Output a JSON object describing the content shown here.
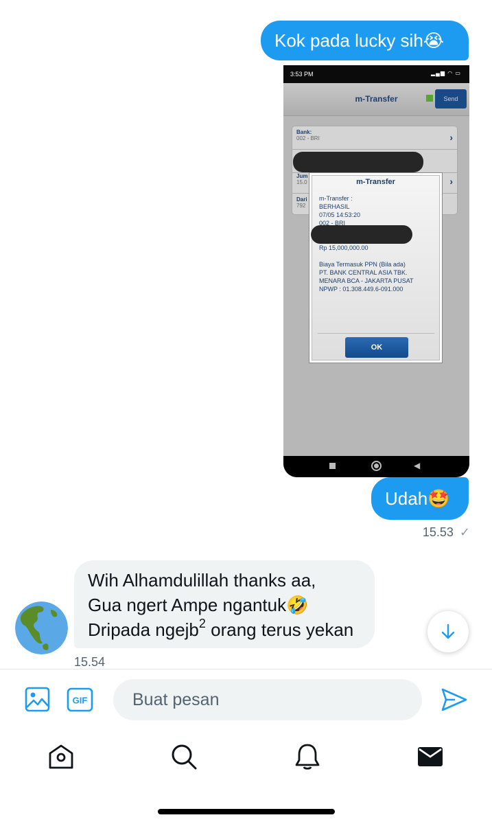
{
  "conversation": {
    "messages": [
      {
        "direction": "outgoing",
        "text": "Kok pada lucky sih😭"
      },
      {
        "direction": "outgoing",
        "type": "image",
        "image": {
          "status_time": "3:53 PM",
          "app_title": "m-Transfer",
          "send_label": "Send",
          "rows": [
            {
              "label": "Bank:",
              "value": "002 - BRI"
            },
            {
              "label": "Jum",
              "value": "15.0"
            },
            {
              "label": "Dari",
              "value": "792"
            }
          ],
          "dialog": {
            "title": "m-Transfer",
            "lines": [
              "m-Transfer :",
              "BERHASIL",
              "07/05 14:53:20",
              "002 - BRI",
              "Rp 15,000,000.00",
              "Biaya Termasuk PPN (Bila ada)",
              "PT. BANK CENTRAL ASIA TBK.",
              "MENARA BCA - JAKARTA PUSAT",
              "NPWP : 01.308.449.6-091.000"
            ],
            "ok_label": "OK"
          }
        }
      },
      {
        "direction": "outgoing",
        "text": "Udah🤩"
      },
      {
        "direction": "incoming",
        "text_lines": [
          "Wih Alhamdulillah thanks aa,",
          "Gua ngert Ampe ngantuk🤣",
          "Dripada ngejb",
          "2",
          " orang terus yekan"
        ]
      }
    ],
    "outgoing_time": "15.53",
    "outgoing_status": "✓",
    "incoming_time": "15.54"
  },
  "composer": {
    "placeholder": "Buat pesan",
    "gif_label": "GIF"
  },
  "icons": {
    "media": "image-icon",
    "gif": "gif-icon",
    "send": "send-icon",
    "scroll_down": "arrow-down-icon",
    "home": "home-icon",
    "search": "search-icon",
    "notifications": "bell-icon",
    "messages": "mail-icon"
  },
  "colors": {
    "accent": "#1d9bf0",
    "incoming_bubble": "#eff3f4",
    "secondary_text": "#536471"
  }
}
